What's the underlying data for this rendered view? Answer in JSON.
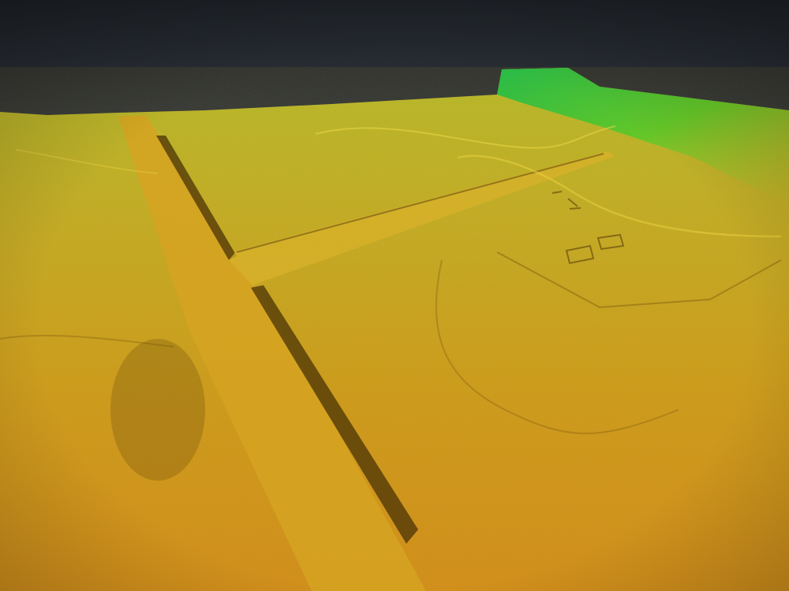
{
  "scene": {
    "kind": "3d-lidar-terrain-view",
    "colormap": "elevation",
    "colors": {
      "sky_top": "#1d2126",
      "sky_bottom": "#343a42",
      "terrain_low": "#d99a1f",
      "terrain_mid": "#c9b22a",
      "terrain_high": "#6fcf22",
      "terrain_peak": "#19c84a",
      "shadow": "#5a3e08"
    },
    "features": [
      "raised-road-embankment",
      "field-boundary-ridges",
      "small-structure-footprints"
    ]
  }
}
